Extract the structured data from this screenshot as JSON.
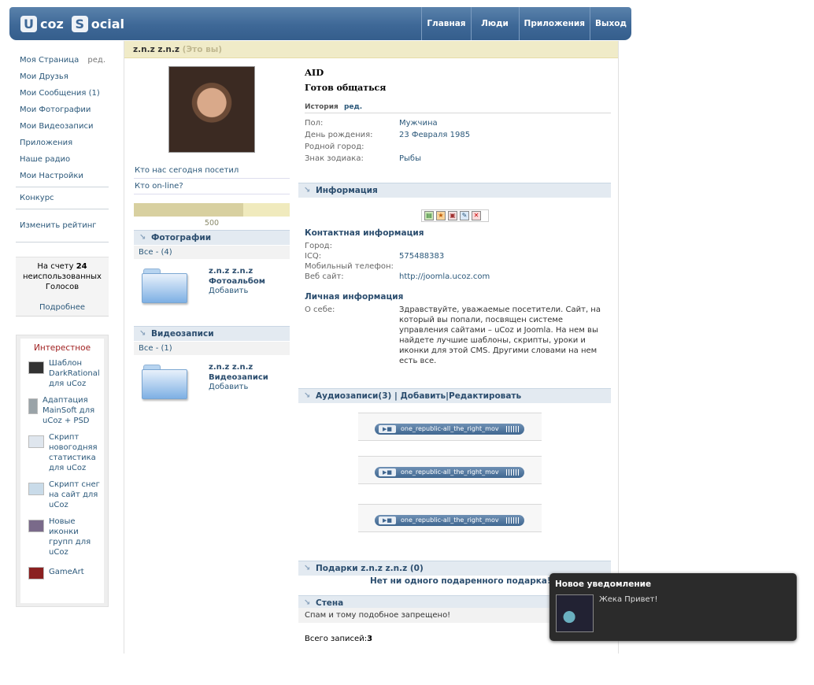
{
  "header": {
    "logo_u": "U",
    "logo_coz": "coz",
    "logo_s": "S",
    "logo_ocial": "ocial",
    "nav": [
      "Главная",
      "Люди",
      "Приложения",
      "Выход"
    ]
  },
  "leftnav": {
    "items": [
      {
        "label": "Моя Страница",
        "extra": "ред."
      },
      {
        "label": "Мои Друзья"
      },
      {
        "label": "Мои Сообщения (1)"
      },
      {
        "label": "Мои Фотографии"
      },
      {
        "label": "Мои Видеозаписи"
      },
      {
        "label": "Приложения"
      },
      {
        "label": "Наше радио"
      },
      {
        "label": "Мои Настройки"
      }
    ],
    "contest": "Конкурс",
    "change_rating": "Изменить рейтинг"
  },
  "votes": {
    "line1": "На счету",
    "count": "24",
    "line2": "неиспользованных",
    "line3": "Голосов",
    "more": "Подробнее"
  },
  "interesting": {
    "title": "Интерестное",
    "items": [
      {
        "text": "Шаблон DarkRational для uCoz",
        "thumb_color": "#333333"
      },
      {
        "text": "Адаптация MainSoft для uCoz + PSD",
        "thumb_color": "#9aa3a8"
      },
      {
        "text": "Скрипт новогодняя статистика для uCoz",
        "thumb_color": "#dfe6ee"
      },
      {
        "text": "Скрипт снег на сайт для uCoz",
        "thumb_color": "#c9dbe9"
      },
      {
        "text": "Новые иконки групп для uCoz",
        "thumb_color": "#7a6a8a"
      },
      {
        "text": "GameArt",
        "thumb_color": "#8a2020"
      }
    ]
  },
  "profile": {
    "title_name": "z.n.z z.n.z",
    "title_you": "(Это вы)",
    "who_visited": "Кто нас сегодня посетил",
    "who_online": "Кто on-line?",
    "rating_value": "500",
    "rating_fraction": 0.7,
    "name": "AID",
    "status": "Готов общаться",
    "history_label": "История",
    "history_edit": "ред.",
    "fields": [
      {
        "k": "Пол:",
        "v": "Мужчина"
      },
      {
        "k": "День рождения:",
        "v": "23 Февраля 1985"
      },
      {
        "k": "Родной город:",
        "v": ""
      },
      {
        "k": "Знак зодиака:",
        "v": "Рыбы"
      }
    ]
  },
  "photos": {
    "header": "Фотографии",
    "all": "Все - (4)",
    "album_owner": "z.n.z z.n.z",
    "album_name": "Фотоальбом",
    "add": "Добавить"
  },
  "videos": {
    "header": "Видеозаписи",
    "all": "Все - (1)",
    "album_owner": "z.n.z z.n.z",
    "album_name": "Видеозаписи",
    "add": "Добавить"
  },
  "info": {
    "header": "Информация",
    "contact_title": "Контактная информация",
    "contact": [
      {
        "k": "Город:",
        "v": ""
      },
      {
        "k": "ICQ:",
        "v": "575488383"
      },
      {
        "k": "Мобильный телефон:",
        "v": ""
      },
      {
        "k": "Веб сайт:",
        "v": "http://joomla.ucoz.com"
      }
    ],
    "personal_title": "Личная информация",
    "about_label": "О себе:",
    "about_text": "Здравствуйте, уважаемые посетители. Сайт, на который вы попали, посвящен системе управления сайтами – uCoz и Joomla. На нем вы найдете лучшие шаблоны, скрипты, уроки и иконки для этой CMS. Другими словами на нем есть все."
  },
  "audio": {
    "header": "Аудиозаписи(3) | Добавить|Редактировать",
    "tracks": [
      "one_republic-all_the_right_mov",
      "one_republic-all_the_right_mov",
      "one_republic-all_the_right_mov"
    ]
  },
  "gifts": {
    "header": "Подарки z.n.z z.n.z (0)",
    "empty": "Нет ни одного подаренного подарка!"
  },
  "wall": {
    "header": "Стена",
    "message": "Спам и тому подобное запрещено!",
    "total_label": "Всего записей:",
    "total": "3"
  },
  "notification": {
    "title": "Новое уведомление",
    "text": "Жека Привет!"
  },
  "colors": {
    "header_blue": "#3e6897",
    "link": "#2b587a",
    "title_bar": "#f0ebc8",
    "section_bar": "#e3eaf1",
    "notification_bg": "#2b2b2b"
  }
}
